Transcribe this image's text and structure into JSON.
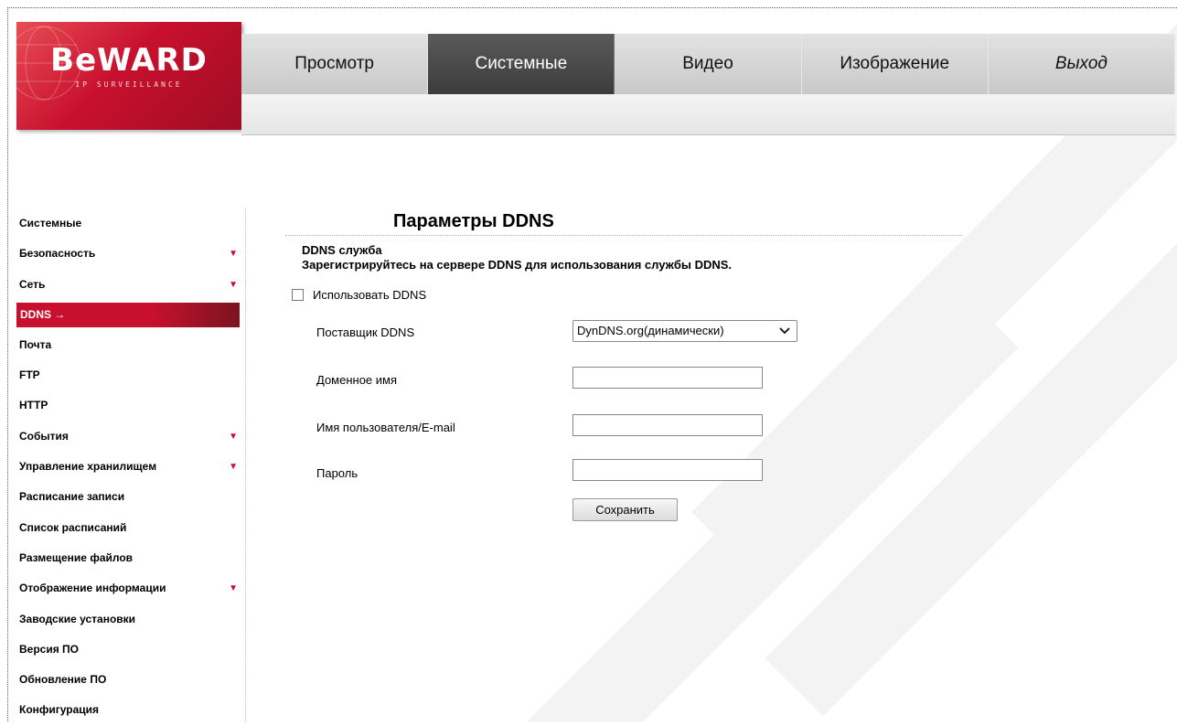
{
  "brand": {
    "logo_text": "BeWARD",
    "tagline": "IP SURVEILLANCE",
    "accent_color": "#c8102e"
  },
  "nav": {
    "tabs": [
      {
        "label": "Просмотр"
      },
      {
        "label": "Системные",
        "active": true
      },
      {
        "label": "Видео"
      },
      {
        "label": "Изображение"
      },
      {
        "label": "Выход"
      }
    ]
  },
  "sidebar": {
    "items": [
      {
        "label": "Системные"
      },
      {
        "label": "Безопасность",
        "has_submenu": true
      },
      {
        "label": "Сеть",
        "has_submenu": true
      },
      {
        "label": "DDNS",
        "active": true,
        "active_marker": "→"
      },
      {
        "label": "Почта"
      },
      {
        "label": "FTP"
      },
      {
        "label": "HTTP"
      },
      {
        "label": "События",
        "has_submenu": true
      },
      {
        "label": "Управление хранилищем",
        "has_submenu": true
      },
      {
        "label": "Расписание записи"
      },
      {
        "label": "Список расписаний"
      },
      {
        "label": "Размещение файлов"
      },
      {
        "label": "Отображение информации",
        "has_submenu": true
      },
      {
        "label": "Заводские установки"
      },
      {
        "label": "Версия ПО"
      },
      {
        "label": "Обновление ПО"
      },
      {
        "label": "Конфигурация"
      }
    ],
    "submenu_arrow": "▼"
  },
  "main": {
    "title": "Параметры DDNS",
    "section_title": "DDNS служба",
    "section_note": "Зарегистрируйтесь на сервере DDNS для использования службы DDNS.",
    "use_ddns": {
      "label": "Использовать DDNS",
      "checked": false
    },
    "provider": {
      "label": "Поставщик DDNS",
      "value": "DynDNS.org(динамически)"
    },
    "domain": {
      "label": "Доменное имя",
      "value": ""
    },
    "username": {
      "label": "Имя пользователя/E-mail",
      "value": ""
    },
    "password": {
      "label": "Пароль",
      "value": ""
    },
    "save_label": "Сохранить"
  }
}
